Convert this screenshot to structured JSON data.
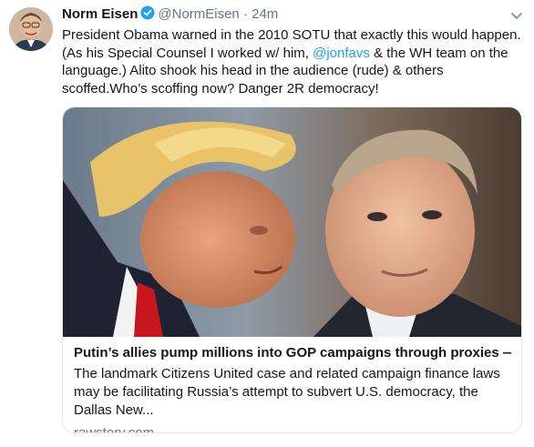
{
  "tweet": {
    "author_name": "Norm Eisen",
    "author_handle": "@NormEisen",
    "separator": "·",
    "timestamp": "24m",
    "verified_icon": "verified-badge-icon",
    "text_part1": "President Obama warned in the 2010 SOTU that exactly this would happen. (As his Special Counsel I worked w/ him, ",
    "mention": "@jonfavs",
    "text_part2": " & the WH team on the  language.) Alito shook his head in the audience (rude) & others scoffed.Who’s scoffing now? Danger 2R democracy!"
  },
  "card": {
    "image_icon": "article-photo",
    "title": "Putin’s allies pump millions into GOP campaigns through proxies — t...",
    "description": "The landmark Citizens United case and related campaign finance laws may be facilitating Russia’s attempt to subvert U.S. democracy, the Dallas New...",
    "domain": "rawstory.com"
  },
  "colors": {
    "link": "#1da1f2",
    "secondary_text": "#657786",
    "card_border": "#e1e8ed"
  }
}
